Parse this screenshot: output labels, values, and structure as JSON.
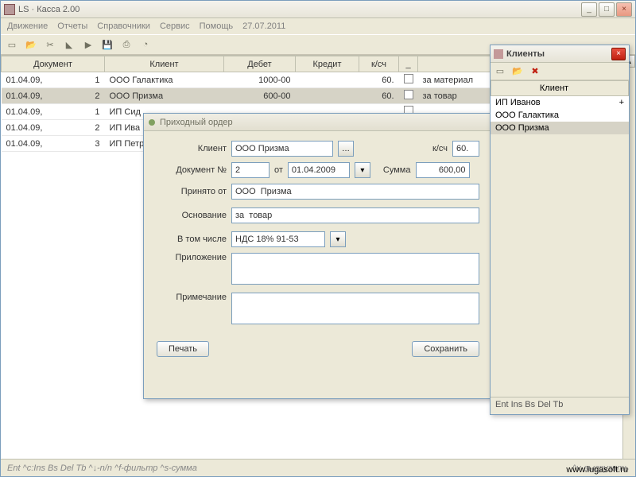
{
  "window": {
    "title": "LS · Касса 2.00"
  },
  "menu": {
    "items": [
      "Движение",
      "Отчеты",
      "Справочники",
      "Сервис",
      "Помощь",
      "27.07.2011"
    ]
  },
  "grid": {
    "headers": {
      "doc": "Документ",
      "client": "Клиент",
      "debit": "Дебет",
      "credit": "Кредит",
      "acct": "к/сч",
      "flag": "_",
      "desc": " "
    },
    "rows": [
      {
        "date": "01.04.09,",
        "num": "1",
        "client": "ООО Галактика",
        "debit": "1000-00",
        "credit": "",
        "acct": "60.",
        "desc": "за материал"
      },
      {
        "date": "01.04.09,",
        "num": "2",
        "client": "ООО Призма",
        "debit": "600-00",
        "credit": "",
        "acct": "60.",
        "desc": "за товар",
        "sel": true
      },
      {
        "date": "01.04.09,",
        "num": "1",
        "client": "ИП Сид",
        "debit": "",
        "credit": "",
        "acct": "",
        "desc": ""
      },
      {
        "date": "01.04.09,",
        "num": "2",
        "client": "ИП Ива",
        "debit": "",
        "credit": "",
        "acct": "",
        "desc": ""
      },
      {
        "date": "01.04.09,",
        "num": "3",
        "client": "ИП Петр",
        "debit": "",
        "credit": "",
        "acct": "",
        "desc": ""
      }
    ]
  },
  "order": {
    "title": "Приходный ордер",
    "labels": {
      "client": "Клиент",
      "acct": "к/сч",
      "docnum": "Документ №",
      "from": "от",
      "sum": "Сумма",
      "received": "Принято от",
      "basis": "Основание",
      "incl": "В том числе",
      "attach": "Приложение",
      "note": "Примечание"
    },
    "values": {
      "client": "ООО Призма",
      "acct": "60.",
      "docnum": "2",
      "date": "01.04.2009",
      "sum": "600,00",
      "received": "ООО  Призма",
      "basis": "за  товар",
      "incl": "НДС 18% 91-53",
      "attach": "",
      "note": ""
    },
    "buttons": {
      "print": "Печать",
      "save": "Сохранить"
    }
  },
  "clients": {
    "title": "Клиенты",
    "header": "Клиент",
    "items": [
      {
        "name": "ИП Иванов",
        "mark": "+"
      },
      {
        "name": "ООО Галактика",
        "mark": ""
      },
      {
        "name": "ООО Призма",
        "mark": "",
        "sel": true
      }
    ],
    "footer": "Ent Ins Bs Del Tb"
  },
  "status": {
    "left": "Ent ^c:Ins Bs Del Tb  ^↓-n/n  ^f-фильтр ^s-сумма",
    "right_hint": "^v-выгрузить",
    "link": "www.lugasoft.ru"
  }
}
